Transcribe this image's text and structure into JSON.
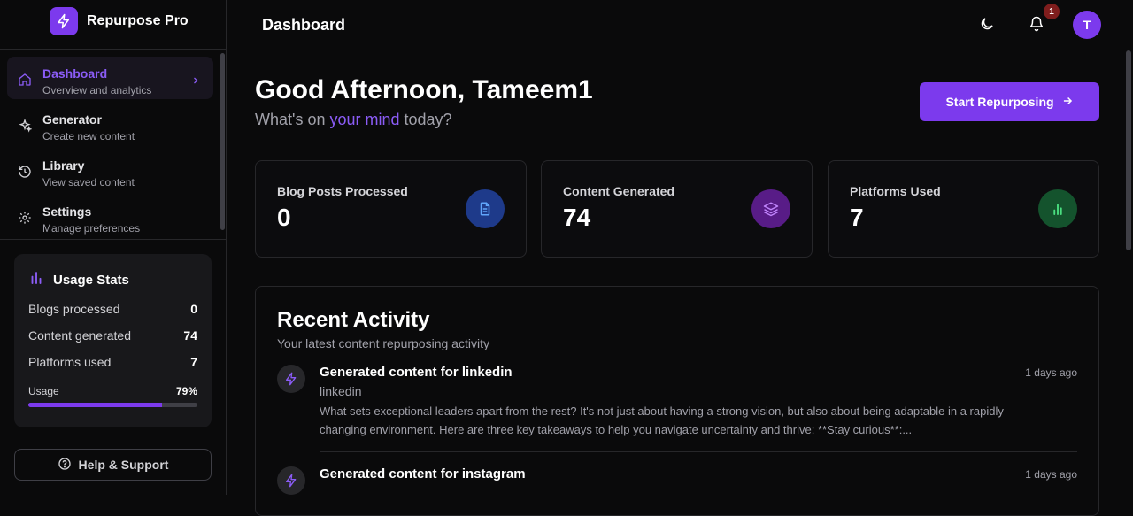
{
  "app": {
    "name": "Repurpose Pro"
  },
  "sidebar": {
    "items": [
      {
        "label": "Dashboard",
        "sub": "Overview and analytics",
        "icon": "home-icon",
        "active": true
      },
      {
        "label": "Generator",
        "sub": "Create new content",
        "icon": "sparkles-icon"
      },
      {
        "label": "Library",
        "sub": "View saved content",
        "icon": "history-icon"
      },
      {
        "label": "Settings",
        "sub": "Manage preferences",
        "icon": "gear-icon"
      }
    ],
    "usage": {
      "title": "Usage Stats",
      "rows": [
        {
          "label": "Blogs processed",
          "value": "0"
        },
        {
          "label": "Content generated",
          "value": "74"
        },
        {
          "label": "Platforms used",
          "value": "7"
        }
      ],
      "usage_label": "Usage",
      "usage_value": "79%",
      "usage_fraction": 0.79
    },
    "help": "Help & Support"
  },
  "header": {
    "title": "Dashboard",
    "notification_count": "1",
    "avatar_initial": "T"
  },
  "main": {
    "greeting": "Good Afternoon, Tameem1",
    "sub_before": "What's on ",
    "sub_highlight": "your mind",
    "sub_after": " today?",
    "cta": "Start Repurposing",
    "stats": [
      {
        "label": "Blog Posts Processed",
        "value": "0",
        "color": "#1e3a8a",
        "icon": "document-icon",
        "icon_color": "#60a5fa"
      },
      {
        "label": "Content Generated",
        "value": "74",
        "color": "#581c87",
        "icon": "layers-icon",
        "icon_color": "#c084fc"
      },
      {
        "label": "Platforms Used",
        "value": "7",
        "color": "#14532d",
        "icon": "bar-chart-icon",
        "icon_color": "#4ade80"
      }
    ],
    "activity": {
      "title": "Recent Activity",
      "subtitle": "Your latest content repurposing activity",
      "items": [
        {
          "title": "Generated content for linkedin",
          "platform": "linkedin",
          "time": "1 days ago",
          "desc": "What sets exceptional leaders apart from the rest? It's not just about having a strong vision, but also about being adaptable in a rapidly changing environment. Here are three key takeaways to help you navigate uncertainty and thrive: **Stay curious**:..."
        },
        {
          "title": "Generated content for instagram",
          "platform": "",
          "time": "1 days ago",
          "desc": ""
        }
      ]
    }
  }
}
